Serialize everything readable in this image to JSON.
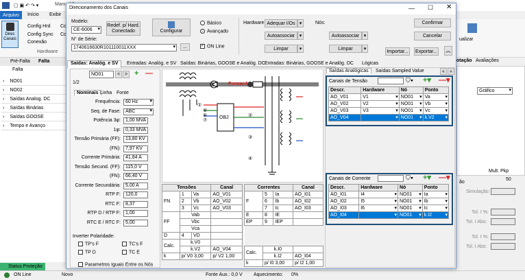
{
  "app": {
    "title_prefix": "Manual 2",
    "file_tab": "Arquivo",
    "tabs": [
      "Início",
      "Exibir"
    ],
    "ribbon": {
      "direc": "Direc\nCanais",
      "config_hrd": "Config Hrd",
      "config_sync": "Config Sync",
      "conexao": "Conexão",
      "co1": "Co",
      "co2": "Co",
      "group_label": "Hardware"
    },
    "subtabs": [
      "Pré-Falta",
      "Falta"
    ],
    "tree_header": "Falta",
    "tree": [
      "NO01",
      "NO02",
      "Saídas Analog. DC",
      "Saídas Binárias",
      "Saídas GOOSE",
      "Tempo e Avanço"
    ],
    "status_tab": "Status Proteção",
    "status": {
      "online": "ON Line",
      "novo": "Novo",
      "fonte": "Fonte Aux.: 0,0 V",
      "aquec": "Aquecimento:",
      "pct": "0%"
    },
    "right": {
      "tabs": [
        "otação",
        "Avaliações"
      ],
      "grafico": "Gráfico",
      "mult": "Mult. Pkp",
      "v50": "50",
      "simulacao": "Simulação:",
      "tol1": "Tol. I %:",
      "tol1abs": "Tol. I Abs:",
      "tol2": "Tol. t %:",
      "tol2abs": "Tol. t Abs:",
      "atualizar": "ualizar",
      "ao": "ão"
    }
  },
  "dialog": {
    "title": "Direcionamento dos Canais",
    "modelo_label": "Modelo:",
    "modelo": "CE-6006",
    "redef": "Redef. p/ Hard. Conectado",
    "configurar": "Configurar",
    "basico": "Básico",
    "avancado": "Avançado",
    "serie_label": "N° de Série:",
    "serie": "1740616630R101110011XXX",
    "online": "ON Line",
    "hardware_label": "Hardware:",
    "adequar": "Adequar I/Os",
    "autoassociar": "Autoassociar",
    "limpar": "Limpar",
    "nos_label": "Nós:",
    "confirmar": "Confirmar",
    "cancelar": "Cancelar",
    "importar": "Importar...",
    "exportar": "Exportar...",
    "tabs": [
      "Saídas: Analóg. e SV",
      "Entradas: Analóg. e SV",
      "Saídas: Binárias, GOOSE e Analóg. DC",
      "Entradas: Binárias, GOOSE e Analóg. DC",
      "Lógicas"
    ]
  },
  "node": {
    "name": "NO01",
    "page": "1/2",
    "subtabs": [
      "Nominais",
      "Linha",
      "Fonte"
    ],
    "fields": [
      {
        "label": "Frequência:",
        "value": "60 Hz"
      },
      {
        "label": "Seq. de Fase:",
        "value": "ABC"
      },
      {
        "label": "Potência 3φ:",
        "value": "1,00 MVA"
      },
      {
        "label": "1φ:",
        "value": "0,33 MVA"
      },
      {
        "label": "Tensão Primária (FF):",
        "value": "13,80 KV"
      },
      {
        "label": "(FN):",
        "value": "7,97 KV"
      },
      {
        "label": "Corrente Primária:",
        "value": "41,84 A"
      },
      {
        "label": "Tensão Secund. (FF):",
        "value": "115,0 V"
      },
      {
        "label": "(FN):",
        "value": "66,40 V"
      },
      {
        "label": "Corrente Secundária:",
        "value": "5,00 A"
      },
      {
        "label": "RTP F:",
        "value": "120,0"
      },
      {
        "label": "RTC F:",
        "value": "8,37"
      },
      {
        "label": "RTP D / RTP F:",
        "value": "1,00"
      },
      {
        "label": "RTC E / RTC F:",
        "value": "5,00"
      }
    ],
    "inverter": "Inverter Polaridade:",
    "tps_f": "TP's F",
    "tcs_f": "TC's F",
    "tp_d": "TP D",
    "tc_e": "TC E",
    "params": "Parametros Iguais Entre os Nós"
  },
  "diagram": {
    "forward": "Forward",
    "obj": "OBJ",
    "nums": [
      "①",
      "⑤",
      "⑥",
      "⑦",
      "②",
      "③",
      "④",
      "⑧",
      "⑨"
    ]
  },
  "tensoes": {
    "h1": "Tensões",
    "h2": "Canal",
    "fn": "FN",
    "ff": "FF",
    "d": "D",
    "calc": "Calc.",
    "rows": [
      [
        "1",
        "Va",
        "AO_V01"
      ],
      [
        "2",
        "Vb",
        "AO_V02"
      ],
      [
        "3",
        "Vc",
        "AO_V03"
      ]
    ],
    "ffrows": [
      [
        "Vab",
        ""
      ],
      [
        "Vbc",
        ""
      ],
      [
        "Vca",
        ""
      ]
    ],
    "drow": [
      "4",
      "VD",
      ""
    ],
    "calcrows": [
      [
        "k.V0",
        ""
      ],
      [
        "k.V2",
        "AO_V04"
      ]
    ],
    "k": "k",
    "pv0": "p/ V0",
    "pv0v": "3,00",
    "pv2": "p/ V2",
    "pv2v": "1,00"
  },
  "correntes": {
    "h1": "Correntes",
    "h2": "Canal",
    "f": "F",
    "e": "E",
    "ep": "EP",
    "calc": "Calc.",
    "rows": [
      [
        "5",
        "Ia",
        "AO_I01"
      ],
      [
        "6",
        "Ib",
        "AO_I02"
      ],
      [
        "7",
        "Ic",
        "AO_I03"
      ]
    ],
    "erow": [
      "8",
      "IE",
      ""
    ],
    "eprow": [
      "9",
      "IEP",
      ""
    ],
    "calcrows": [
      [
        "k.I0",
        ""
      ],
      [
        "k.I2",
        "AO_I04"
      ]
    ],
    "k": "k",
    "pi0": "p/ I0",
    "pi0v": "3,00",
    "pi2": "p/ I2",
    "pi2v": "1,00"
  },
  "side": {
    "tabs": [
      "Saídas Analógicas",
      "Saídas Sampled Value"
    ],
    "tensao_title": "Canais de Tensão",
    "corrente_title": "Canais de Corrente",
    "headers": [
      "Descr.",
      "Hardware",
      "Nó",
      "Ponto"
    ],
    "tensao": [
      [
        "AO_V01",
        "V1",
        "NO01",
        "Va"
      ],
      [
        "AO_V02",
        "V2",
        "NO01",
        "Vb"
      ],
      [
        "AO_V03",
        "V3",
        "NO01",
        "Vc"
      ],
      [
        "AO_V04",
        "",
        "NO01",
        "k.V2"
      ]
    ],
    "corrente": [
      [
        "AO_I01",
        "I4",
        "NO01",
        "Ia"
      ],
      [
        "AO_I02",
        "I5",
        "NO01",
        "Ib"
      ],
      [
        "AO_I03",
        "I6",
        "NO01",
        "Ic"
      ],
      [
        "AO_I04",
        "",
        "NO01",
        "k.I2"
      ]
    ]
  },
  "colors": {
    "accent": "#0063b1",
    "selected": "#0078d7",
    "highlight_border": "#1f4e79",
    "status_green": "#3cb371"
  }
}
